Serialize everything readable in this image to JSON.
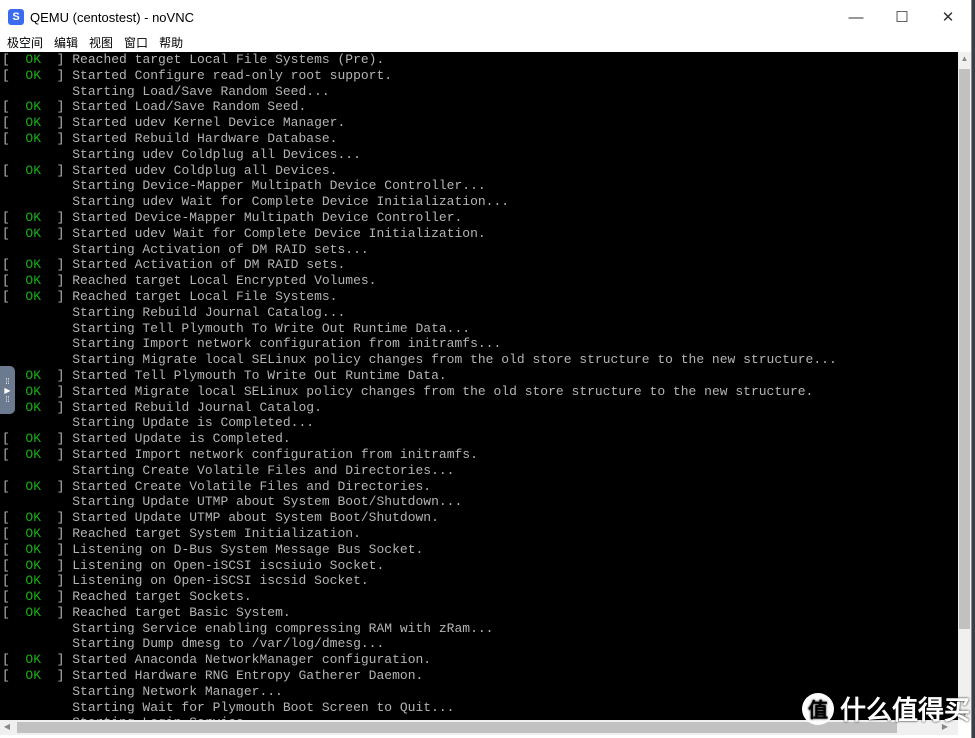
{
  "window": {
    "title": "QEMU (centostest) - noVNC",
    "app_icon": "noVNC-logo-icon",
    "controls": {
      "minimize": "—",
      "maximize": "☐",
      "close": "✕"
    }
  },
  "menu": [
    "极空间",
    "编辑",
    "视图",
    "窗口",
    "帮助"
  ],
  "colors": {
    "ok": "#17b017",
    "text": "#b4b4b4",
    "background": "#000000"
  },
  "terminal": {
    "ok_label": "OK",
    "lines": [
      {
        "ok": true,
        "text": "Reached target Local File Systems (Pre)."
      },
      {
        "ok": true,
        "text": "Started Configure read-only root support."
      },
      {
        "ok": false,
        "text": "Starting Load/Save Random Seed..."
      },
      {
        "ok": true,
        "text": "Started Load/Save Random Seed."
      },
      {
        "ok": true,
        "text": "Started udev Kernel Device Manager."
      },
      {
        "ok": true,
        "text": "Started Rebuild Hardware Database."
      },
      {
        "ok": false,
        "text": "Starting udev Coldplug all Devices..."
      },
      {
        "ok": true,
        "text": "Started udev Coldplug all Devices."
      },
      {
        "ok": false,
        "text": "Starting Device-Mapper Multipath Device Controller..."
      },
      {
        "ok": false,
        "text": "Starting udev Wait for Complete Device Initialization..."
      },
      {
        "ok": true,
        "text": "Started Device-Mapper Multipath Device Controller."
      },
      {
        "ok": true,
        "text": "Started udev Wait for Complete Device Initialization."
      },
      {
        "ok": false,
        "text": "Starting Activation of DM RAID sets..."
      },
      {
        "ok": true,
        "text": "Started Activation of DM RAID sets."
      },
      {
        "ok": true,
        "text": "Reached target Local Encrypted Volumes."
      },
      {
        "ok": true,
        "text": "Reached target Local File Systems."
      },
      {
        "ok": false,
        "text": "Starting Rebuild Journal Catalog..."
      },
      {
        "ok": false,
        "text": "Starting Tell Plymouth To Write Out Runtime Data..."
      },
      {
        "ok": false,
        "text": "Starting Import network configuration from initramfs..."
      },
      {
        "ok": false,
        "text": "Starting Migrate local SELinux policy changes from the old store structure to the new structure..."
      },
      {
        "ok": true,
        "text": "Started Tell Plymouth To Write Out Runtime Data."
      },
      {
        "ok": true,
        "text": "Started Migrate local SELinux policy changes from the old store structure to the new structure."
      },
      {
        "ok": true,
        "text": "Started Rebuild Journal Catalog."
      },
      {
        "ok": false,
        "text": "Starting Update is Completed..."
      },
      {
        "ok": true,
        "text": "Started Update is Completed."
      },
      {
        "ok": true,
        "text": "Started Import network configuration from initramfs."
      },
      {
        "ok": false,
        "text": "Starting Create Volatile Files and Directories..."
      },
      {
        "ok": true,
        "text": "Started Create Volatile Files and Directories."
      },
      {
        "ok": false,
        "text": "Starting Update UTMP about System Boot/Shutdown..."
      },
      {
        "ok": true,
        "text": "Started Update UTMP about System Boot/Shutdown."
      },
      {
        "ok": true,
        "text": "Reached target System Initialization."
      },
      {
        "ok": true,
        "text": "Listening on D-Bus System Message Bus Socket."
      },
      {
        "ok": true,
        "text": "Listening on Open-iSCSI iscsiuio Socket."
      },
      {
        "ok": true,
        "text": "Listening on Open-iSCSI iscsid Socket."
      },
      {
        "ok": true,
        "text": "Reached target Sockets."
      },
      {
        "ok": true,
        "text": "Reached target Basic System."
      },
      {
        "ok": false,
        "text": "Starting Service enabling compressing RAM with zRam..."
      },
      {
        "ok": false,
        "text": "Starting Dump dmesg to /var/log/dmesg..."
      },
      {
        "ok": true,
        "text": "Started Anaconda NetworkManager configuration."
      },
      {
        "ok": true,
        "text": "Started Hardware RNG Entropy Gatherer Daemon."
      },
      {
        "ok": false,
        "text": "Starting Network Manager..."
      },
      {
        "ok": false,
        "text": "Starting Wait for Plymouth Boot Screen to Quit..."
      },
      {
        "ok": false,
        "text": "Starting Login Service..."
      }
    ]
  },
  "watermark": {
    "logo": "值",
    "text": "什么值得买"
  }
}
